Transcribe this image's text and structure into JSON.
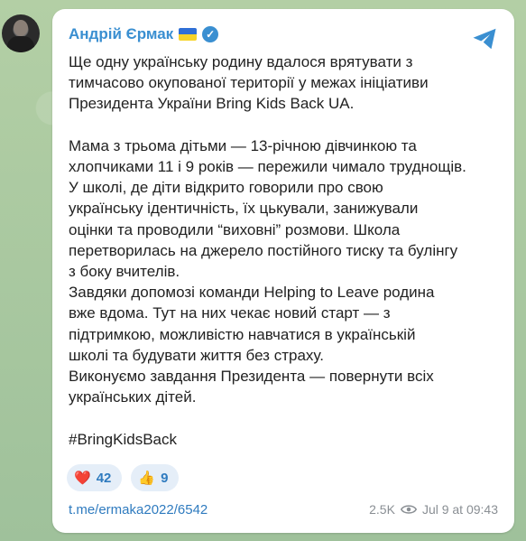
{
  "author": {
    "name": "Андрій Єрмак"
  },
  "message": {
    "text": "Ще одну українську родину вдалося врятувати з\nтимчасово окупованої території у межах ініціативи\nПрезидента України Bring Kids Back UA.\n\nМама з трьома дітьми — 13-річною дівчинкою та\nхлопчиками 11 і 9 років — пережили чимало труднощів.\nУ школі, де діти відкрито говорили про свою\nукраїнську ідентичність, їх цькували, занижували\nоцінки та проводили “виховні” розмови. Школа\nперетворилась на джерело постійного тиску та булінгу\nз боку вчителів.\nЗавдяки допомозі команди Helping to Leave родина\nвже вдома. Тут на них чекає новий старт — з\nпідтримкою, можливістю навчатися в українській\nшколі та будувати життя без страху.\nВиконуємо завдання Президента — повернути всіх\nукраїнських дітей.\n\n#BringKidsBack"
  },
  "reactions": [
    {
      "emoji": "❤️",
      "count": "42"
    },
    {
      "emoji": "👍",
      "count": "9"
    }
  ],
  "footer": {
    "link": "t.me/ermaka2022/6542",
    "views": "2.5K",
    "timestamp": "Jul 9 at 09:43"
  },
  "colors": {
    "accent": "#3a8fd1",
    "background": "#a9c7a0"
  },
  "icons": [
    "verified-badge-icon",
    "share-icon",
    "eye-icon"
  ]
}
